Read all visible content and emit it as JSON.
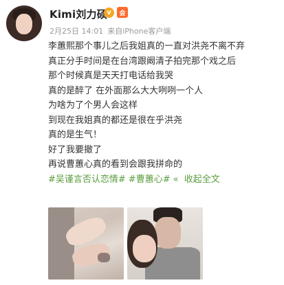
{
  "user": {
    "name": "Kimi刘力硕",
    "verified_badge": "v",
    "vip_badge": "会"
  },
  "meta": {
    "time": "2月25日 14:01",
    "source_prefix": "来自",
    "source": "iPhone客户端"
  },
  "post": {
    "lines": [
      "李蕙熙那个事儿之后我姐真的一直对洪尧不离不弃",
      "真正分手时间是在台湾跟阚清子拍完那个戏之后",
      "那个时候真是天天打电话给我哭",
      "真的是醉了 在外面那么大大咧咧一个人",
      "为啥为了个男人会这样",
      "到现在我姐真的都还是很在乎洪尧",
      "真的是生气！",
      "好了我要撤了",
      "再说曹蕙心真的看到会跟我拼命的"
    ],
    "tags": [
      "#吴谨言否认恋情#",
      "#曹蕙心#"
    ],
    "expand_label": "收起全文"
  },
  "colors": {
    "link_green": "#5a9e3f",
    "meta_gray": "#999999",
    "text": "#333333"
  }
}
